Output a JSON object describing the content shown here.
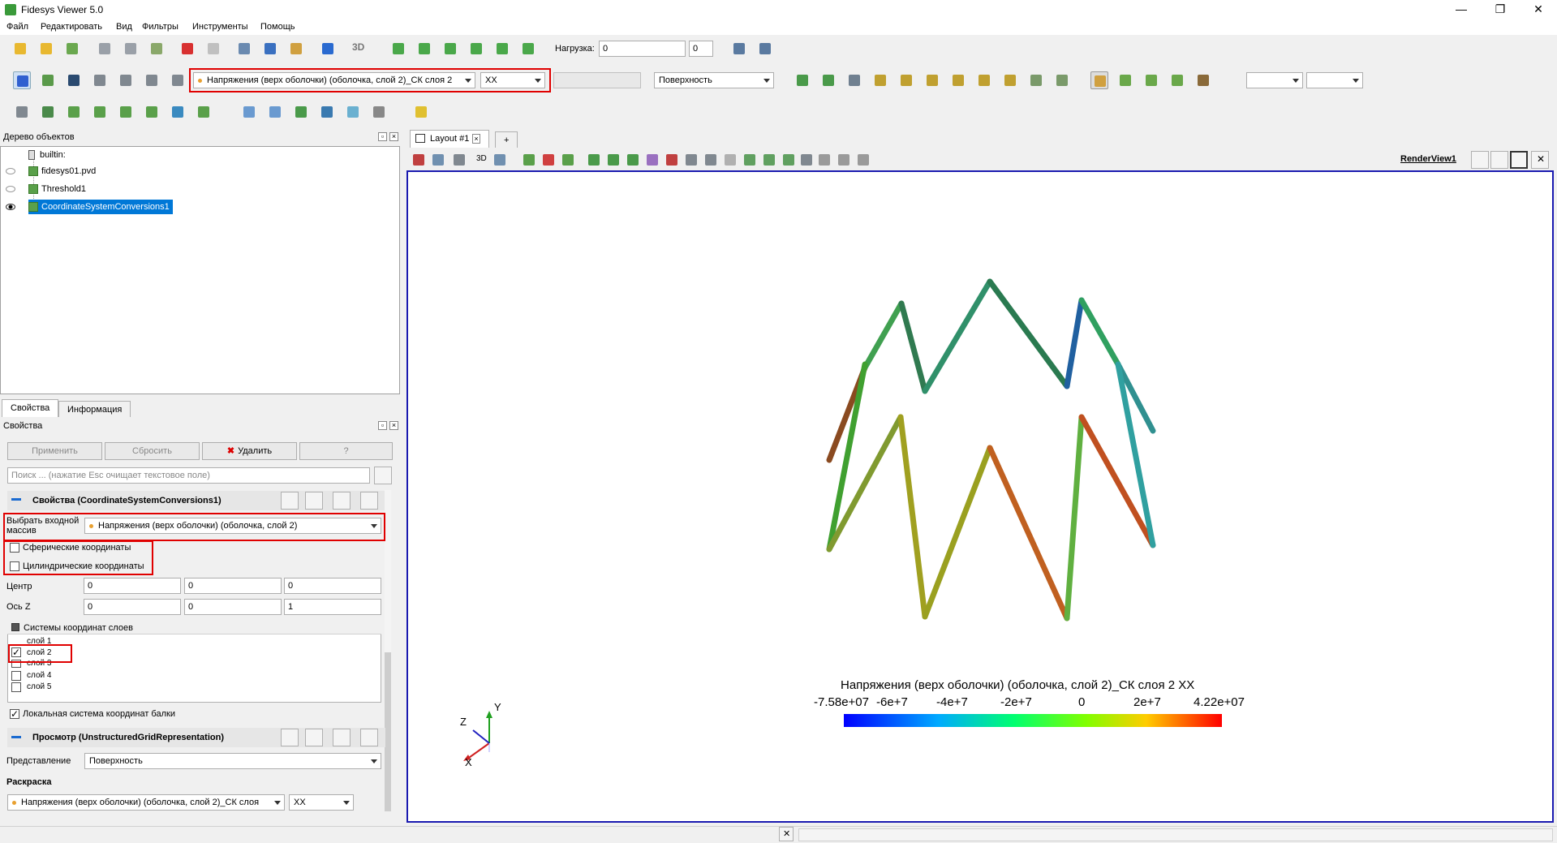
{
  "window": {
    "title": "Fidesys Viewer 5.0",
    "minimize": "—",
    "maximize": "❐",
    "close": "✕"
  },
  "menu": [
    "Файл",
    "Редактировать",
    "Вид",
    "Фильтры",
    "Инструменты",
    "Помощь"
  ],
  "toolbar": {
    "load_label": "Нагрузка:",
    "load_value": "0",
    "load_spin_value": "0",
    "field_combo": "Напряжения (верх оболочки) (оболочка, слой 2)_СК слоя 2",
    "component_combo": "XX",
    "representation_combo": "Поверхность",
    "mode_3d": "3D"
  },
  "object_tree": {
    "title": "Дерево объектов",
    "items": [
      {
        "label": "builtin:"
      },
      {
        "label": "fidesys01.pvd"
      },
      {
        "label": "Threshold1"
      },
      {
        "label": "CoordinateSystemConversions1"
      }
    ]
  },
  "tabs": {
    "properties": "Свойства",
    "info": "Информация"
  },
  "properties": {
    "title": "Свойства",
    "apply": "Применить",
    "reset": "Сбросить",
    "delete": "Удалить",
    "help": "?",
    "search_placeholder": "Поиск ... (нажатие Esc очищает текстовое поле)",
    "section_props": "Свойства (CoordinateSystemConversions1)",
    "input_array_label": "Выбрать входной массив",
    "input_array_value": "Напряжения (верх оболочки) (оболочка, слой 2)",
    "spherical": "Сферические координаты",
    "cylindrical": "Цилиндрические координаты",
    "center_label": "Центр",
    "center": [
      "0",
      "0",
      "0"
    ],
    "axis_label": "Ось Z",
    "axis": [
      "0",
      "0",
      "1"
    ],
    "layers_title": "Системы координат слоев",
    "layers": [
      {
        "label": "слой 1",
        "checked": false
      },
      {
        "label": "слой 2",
        "checked": true
      },
      {
        "label": "слой 3",
        "checked": false
      },
      {
        "label": "слой 4",
        "checked": false
      },
      {
        "label": "слой 5",
        "checked": false
      }
    ],
    "local_beam": "Локальная система координат балки",
    "section_view": "Просмотр (UnstructuredGridRepresentation)",
    "representation_label": "Представление",
    "representation_value": "Поверхность",
    "coloring_label": "Раскраска",
    "coloring_value": "Напряжения (верх оболочки) (оболочка, слой 2)_СК слоя",
    "coloring_component": "XX"
  },
  "layout": {
    "tab_label": "Layout #1",
    "add_tab": "+",
    "view_name": "RenderView1",
    "btn_3d": "3D"
  },
  "legend": {
    "title": "Напряжения (верх оболочки) (оболочка, слой 2)_СК слоя 2 XX",
    "ticks": [
      "-7.58e+07",
      "-6e+7",
      "-4e+7",
      "-2e+7",
      "0",
      "2e+7",
      "4.22e+07"
    ]
  },
  "axes": {
    "x": "X",
    "y": "Y",
    "z": "Z"
  },
  "colors": {
    "accent": "#0078d7",
    "highlight_box": "#e00000",
    "view_border": "#1a1ab0"
  }
}
